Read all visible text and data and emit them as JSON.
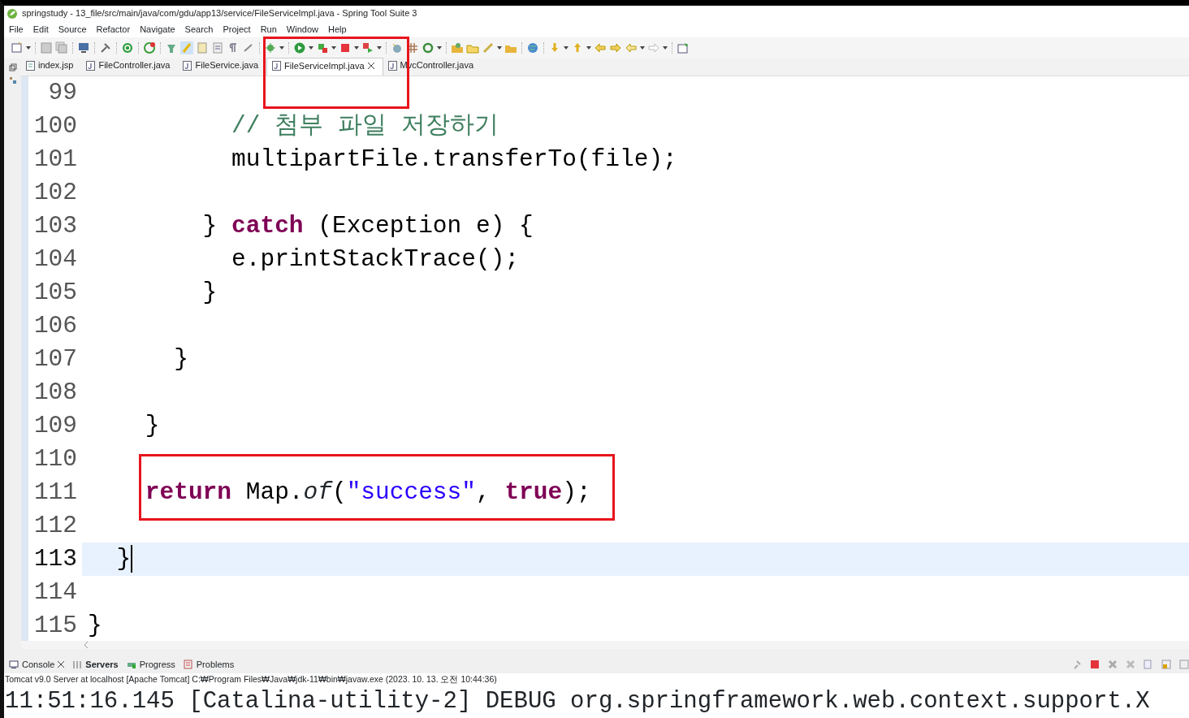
{
  "window": {
    "title": "springstudy - 13_file/src/main/java/com/gdu/app13/service/FileServiceImpl.java - Spring Tool Suite 3"
  },
  "menu": [
    "File",
    "Edit",
    "Source",
    "Refactor",
    "Navigate",
    "Search",
    "Project",
    "Run",
    "Window",
    "Help"
  ],
  "editor_tabs": [
    {
      "label": "index.jsp",
      "kind": "jsp",
      "selected": false
    },
    {
      "label": "FileController.java",
      "kind": "java",
      "selected": false
    },
    {
      "label": "FileService.java",
      "kind": "java",
      "selected": false
    },
    {
      "label": "FileServiceImpl.java",
      "kind": "java",
      "selected": true,
      "highlighted": true
    },
    {
      "label": "MvcController.java",
      "kind": "java",
      "selected": false
    }
  ],
  "code_lines": [
    {
      "number": "99",
      "current": false
    },
    {
      "number": "100",
      "current": false,
      "segments": [
        {
          "text": "          // 첨부 파일 저장하기",
          "kind": "comment"
        }
      ]
    },
    {
      "number": "101",
      "current": false,
      "segments": [
        {
          "text": "          multipartFile.transferTo(file);",
          "kind": "plain"
        }
      ]
    },
    {
      "number": "102",
      "current": false
    },
    {
      "number": "103",
      "current": false,
      "segments": [
        {
          "text": "        } ",
          "kind": "plain"
        },
        {
          "text": "catch",
          "kind": "keyword"
        },
        {
          "text": " (Exception e) {",
          "kind": "plain"
        }
      ]
    },
    {
      "number": "104",
      "current": false,
      "segments": [
        {
          "text": "          e.printStackTrace();",
          "kind": "plain"
        }
      ]
    },
    {
      "number": "105",
      "current": false,
      "segments": [
        {
          "text": "        }",
          "kind": "plain"
        }
      ]
    },
    {
      "number": "106",
      "current": false
    },
    {
      "number": "107",
      "current": false,
      "segments": [
        {
          "text": "      }",
          "kind": "plain"
        }
      ]
    },
    {
      "number": "108",
      "current": false
    },
    {
      "number": "109",
      "current": false,
      "segments": [
        {
          "text": "    }",
          "kind": "plain"
        }
      ]
    },
    {
      "number": "110",
      "current": false
    },
    {
      "number": "111",
      "current": false,
      "highlighted": true,
      "segments": [
        {
          "text": "    return",
          "kind": "keyword"
        },
        {
          "text": " Map.",
          "kind": "plain"
        },
        {
          "text": "of",
          "kind": "method"
        },
        {
          "text": "(",
          "kind": "plain"
        },
        {
          "text": "\"success\"",
          "kind": "string"
        },
        {
          "text": ", ",
          "kind": "plain"
        },
        {
          "text": "true",
          "kind": "keyword"
        },
        {
          "text": ");",
          "kind": "plain"
        }
      ]
    },
    {
      "number": "112",
      "current": false
    },
    {
      "number": "113",
      "current": true,
      "segments": [
        {
          "text": "  }",
          "kind": "plain"
        }
      ]
    },
    {
      "number": "114",
      "current": false
    },
    {
      "number": "115",
      "current": false,
      "segments": [
        {
          "text": "}",
          "kind": "plain"
        }
      ]
    }
  ],
  "console_tabs": [
    {
      "label": "Console",
      "selected": true,
      "bold": false
    },
    {
      "label": "Servers",
      "selected": false,
      "bold": true
    },
    {
      "label": "Progress",
      "selected": false,
      "bold": false
    },
    {
      "label": "Problems",
      "selected": false,
      "bold": false
    }
  ],
  "console": {
    "description": "Tomcat v9.0 Server at localhost [Apache Tomcat] C:₩Program Files₩Java₩jdk-11₩bin₩javaw.exe  (2023. 10. 13. 오전 10:44:36)",
    "output": "11:51:16.145 [Catalina-utility-2] DEBUG org.springframework.web.context.support.X"
  }
}
